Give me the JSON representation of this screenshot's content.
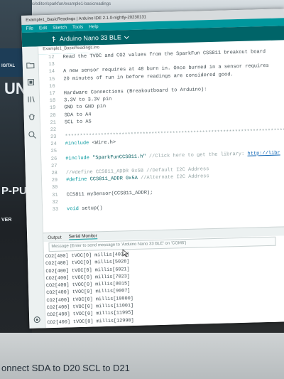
{
  "browser_url": "create.arduino.cc/editor/sparkfun/example1-basicreadings",
  "background": {
    "left_top_label": "IGITAL",
    "left_big_text": "UN",
    "left_mid_text": "P-PU",
    "left_small_text": "VER",
    "bottom_text": "onnect SDA to D20  SCL to D21"
  },
  "window": {
    "title": "Example1_BasicReadings | Arduino IDE 2.1.0-nightly-20230131",
    "menu": [
      "File",
      "Edit",
      "Sketch",
      "Tools",
      "Help"
    ],
    "board": "Arduino Nano 33 BLE",
    "file_tab": "Example1_BasicReadings.ino"
  },
  "code_lines": [
    {
      "n": "12",
      "parts": [
        {
          "t": "Read the TVOC and CO2 values from the SparkFun CSS811 breakout board",
          "c": ""
        }
      ]
    },
    {
      "n": "13",
      "parts": [
        {
          "t": "",
          "c": ""
        }
      ]
    },
    {
      "n": "14",
      "parts": [
        {
          "t": "A new sensor requires at 48 burn in. Once burned in a sensor requires",
          "c": ""
        }
      ]
    },
    {
      "n": "15",
      "parts": [
        {
          "t": "20 minutes of run in before readings are considered good.",
          "c": ""
        }
      ]
    },
    {
      "n": "16",
      "parts": [
        {
          "t": "",
          "c": ""
        }
      ]
    },
    {
      "n": "17",
      "parts": [
        {
          "t": "Hardware Connections (Breakoutboard to Arduino):",
          "c": ""
        }
      ]
    },
    {
      "n": "18",
      "parts": [
        {
          "t": "3.3V to 3.3V pin",
          "c": ""
        }
      ]
    },
    {
      "n": "19",
      "parts": [
        {
          "t": "GND to GND pin",
          "c": ""
        }
      ]
    },
    {
      "n": "20",
      "parts": [
        {
          "t": "SDA to A4",
          "c": ""
        }
      ]
    },
    {
      "n": "21",
      "parts": [
        {
          "t": "SCL to A5",
          "c": ""
        }
      ]
    },
    {
      "n": "22",
      "parts": [
        {
          "t": "",
          "c": ""
        }
      ]
    },
    {
      "n": "23",
      "parts": [
        {
          "t": "*****************************************************************************/",
          "c": "cm"
        }
      ]
    },
    {
      "n": "24",
      "parts": [
        {
          "t": "#include ",
          "c": "kw"
        },
        {
          "t": "<Wire.h>",
          "c": ""
        }
      ]
    },
    {
      "n": "25",
      "parts": [
        {
          "t": "",
          "c": ""
        }
      ]
    },
    {
      "n": "26",
      "parts": [
        {
          "t": "#include ",
          "c": "kw"
        },
        {
          "t": "\"SparkFunCCS811.h\"",
          "c": "str"
        },
        {
          "t": " //Click here to get the library: ",
          "c": "cm"
        },
        {
          "t": "http://libr",
          "c": "link"
        }
      ]
    },
    {
      "n": "27",
      "parts": [
        {
          "t": "",
          "c": ""
        }
      ]
    },
    {
      "n": "28",
      "parts": [
        {
          "t": "//#define CCS811_ADDR 0x5B //Default I2C Address",
          "c": "cm"
        }
      ]
    },
    {
      "n": "29",
      "parts": [
        {
          "t": "#define ",
          "c": "kw"
        },
        {
          "t": "CCS811_ADDR 0x5A",
          "c": "str"
        },
        {
          "t": " //Alternate I2C Address",
          "c": "cm"
        }
      ]
    },
    {
      "n": "30",
      "parts": [
        {
          "t": "",
          "c": ""
        }
      ]
    },
    {
      "n": "31",
      "parts": [
        {
          "t": "CCS811 mySensor(CCS811_ADDR);",
          "c": ""
        }
      ]
    },
    {
      "n": "32",
      "parts": [
        {
          "t": "",
          "c": ""
        }
      ]
    },
    {
      "n": "33",
      "parts": [
        {
          "t": "void ",
          "c": "kw"
        },
        {
          "t": "setup()",
          "c": ""
        }
      ]
    }
  ],
  "panel": {
    "tabs": [
      "Output",
      "Serial Monitor"
    ],
    "input_placeholder": "Message (Enter to send message to 'Arduino Nano 33 BLE' on 'COM6')"
  },
  "serial_lines": [
    "CO2[400] tVOC[0] millis[4036]",
    "CO2[400] tVOC[0] millis[5028]",
    "CO2[400] tVOC[0] millis[6021]",
    "CO2[400] tVOC[0] millis[7023]",
    "CO2[400] tVOC[0] millis[8015]",
    "CO2[400] tVOC[0] millis[9007]",
    "CO2[400] tVOC[0] millis[10000]",
    "CO2[400] tVOC[0] millis[11001]",
    "CO2[400] tVOC[0] millis[11995]",
    "CO2[400] tVOC[0] millis[12990]"
  ],
  "icons": [
    "folder-icon",
    "board-icon",
    "library-icon",
    "debug-icon",
    "search-icon",
    "usb-icon",
    "chevron-down-icon",
    "arrow-cursor-icon"
  ]
}
